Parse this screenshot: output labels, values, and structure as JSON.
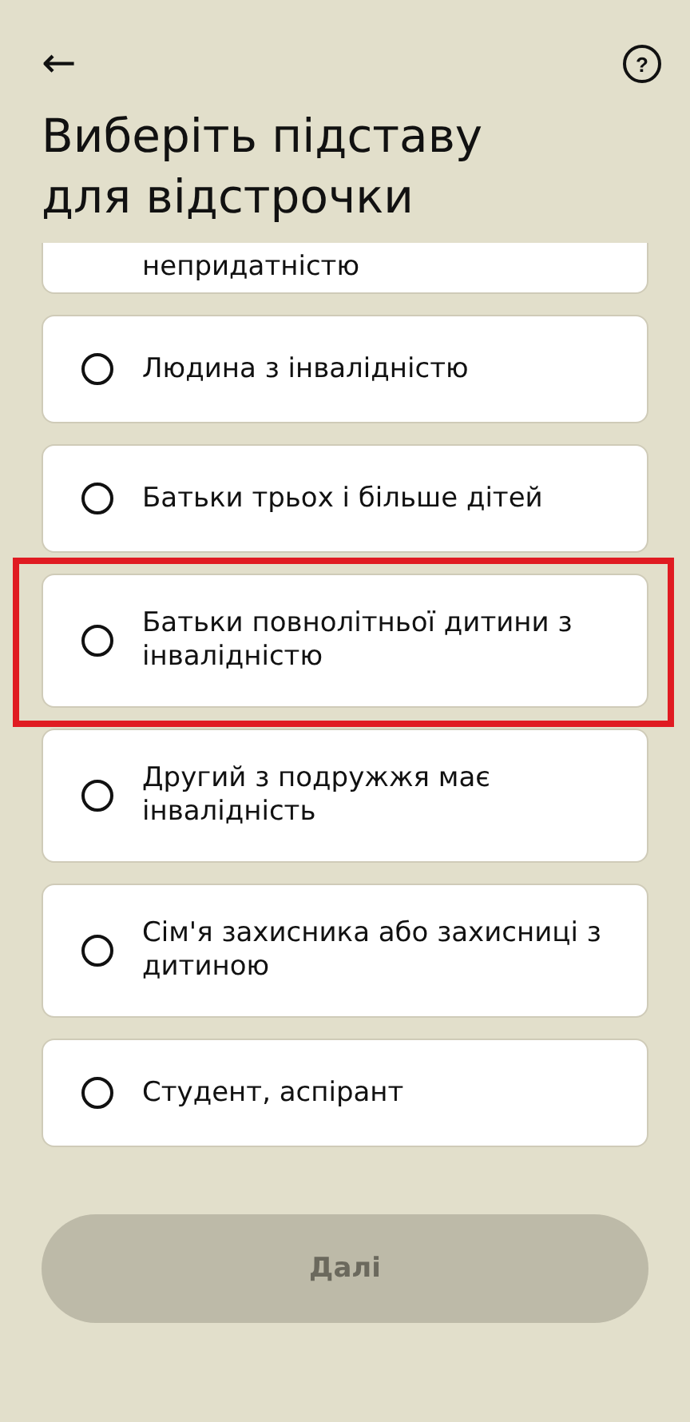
{
  "header": {
    "back": "←",
    "help": "?"
  },
  "title": "Виберіть підставу для відстрочки",
  "options": [
    {
      "label": "непридатністю"
    },
    {
      "label": "Людина з інвалідністю",
      "selected": false,
      "highlighted": false
    },
    {
      "label": "Батьки трьох і більше дітей",
      "selected": false,
      "highlighted": false
    },
    {
      "label": "Батьки повнолітньої дитини з інвалідністю",
      "selected": false,
      "highlighted": true
    },
    {
      "label": "Другий з подружжя має інвалідність",
      "selected": false,
      "highlighted": false
    },
    {
      "label": "Сім'я захисника або захисниці з дитиною",
      "selected": false,
      "highlighted": false
    },
    {
      "label": "Студент, аспірант",
      "selected": false,
      "highlighted": false
    }
  ],
  "next_button": {
    "label": "Далі",
    "disabled": true
  }
}
